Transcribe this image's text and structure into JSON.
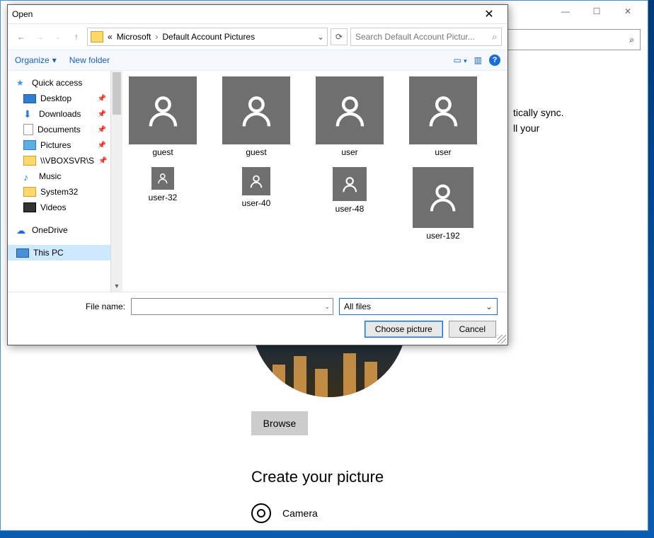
{
  "bg": {
    "text1": "tically sync.",
    "text2": "ll your",
    "browse": "Browse",
    "create": "Create your picture",
    "camera": "Camera"
  },
  "wctl": {
    "min": "—",
    "max": "☐",
    "close": "✕"
  },
  "dialog": {
    "title": "Open",
    "path": {
      "seg1": "Microsoft",
      "seg2": "Default Account Pictures",
      "chevLeft": "«",
      "chev": "›",
      "drop": "⌄"
    },
    "search_placeholder": "Search Default Account Pictur...",
    "toolbar": {
      "organize": "Organize",
      "newfolder": "New folder",
      "drop": "▾",
      "help": "?"
    },
    "filename_label": "File name:",
    "filetype": "All files",
    "choose": "Choose picture",
    "cancel": "Cancel"
  },
  "tree": [
    {
      "label": "Quick access",
      "ico": "star",
      "top": true
    },
    {
      "label": "Desktop",
      "ico": "monitor",
      "pin": true
    },
    {
      "label": "Downloads",
      "ico": "down",
      "pin": true
    },
    {
      "label": "Documents",
      "ico": "doc",
      "pin": true
    },
    {
      "label": "Pictures",
      "ico": "pic",
      "pin": true
    },
    {
      "label": "\\\\VBOXSVR\\S",
      "ico": "net",
      "pin": true
    },
    {
      "label": "Music",
      "ico": "music"
    },
    {
      "label": "System32",
      "ico": "folder"
    },
    {
      "label": "Videos",
      "ico": "vid"
    },
    {
      "label": "OneDrive",
      "ico": "cloud",
      "top": true,
      "gap": true
    },
    {
      "label": "This PC",
      "ico": "pc",
      "top": true,
      "sel": true,
      "gap": true
    }
  ],
  "files_r1": [
    {
      "name": "guest",
      "size": 96
    },
    {
      "name": "guest",
      "size": 96
    },
    {
      "name": "user",
      "size": 96
    },
    {
      "name": "user",
      "size": 96
    }
  ],
  "files_r2": [
    {
      "name": "user-32",
      "size": 32
    },
    {
      "name": "user-40",
      "size": 40
    },
    {
      "name": "user-48",
      "size": 48
    },
    {
      "name": "user-192",
      "size": 86
    }
  ]
}
